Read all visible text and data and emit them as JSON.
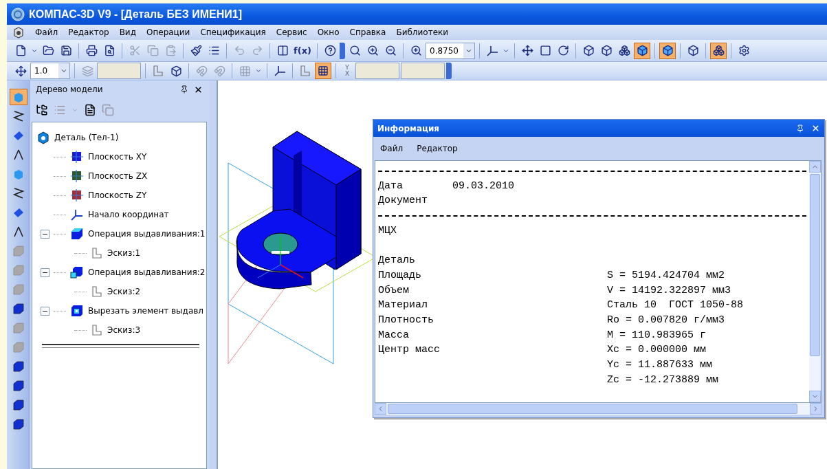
{
  "window": {
    "title": "КОМПАС-3D V9 - [Деталь БЕЗ ИМЕНИ1]"
  },
  "menu": [
    "Файл",
    "Редактор",
    "Вид",
    "Операции",
    "Спецификация",
    "Сервис",
    "Окно",
    "Справка",
    "Библиотеки"
  ],
  "toolbar": [
    {
      "kind": "new"
    },
    {
      "kind": "caret"
    },
    {
      "kind": "open"
    },
    {
      "kind": "save"
    },
    {
      "kind": "separator"
    },
    {
      "kind": "print"
    },
    {
      "kind": "preview"
    },
    {
      "kind": "separator"
    },
    {
      "kind": "cut",
      "disabled": true
    },
    {
      "kind": "copy",
      "disabled": true
    },
    {
      "kind": "paste",
      "disabled": true
    },
    {
      "kind": "separator"
    },
    {
      "kind": "brush"
    },
    {
      "kind": "list"
    },
    {
      "kind": "separator"
    },
    {
      "kind": "undo",
      "disabled": true
    },
    {
      "kind": "redo",
      "disabled": true
    },
    {
      "kind": "separator"
    },
    {
      "kind": "manager"
    },
    {
      "kind": "text",
      "label": "f(x)"
    },
    {
      "kind": "separator"
    },
    {
      "kind": "help"
    },
    {
      "kind": "grip"
    },
    {
      "kind": "search"
    },
    {
      "kind": "zoom-in"
    },
    {
      "kind": "zoom-out"
    },
    {
      "kind": "separator"
    },
    {
      "kind": "zoom-scale"
    },
    {
      "kind": "field",
      "value": "0.8750"
    },
    {
      "kind": "separator"
    },
    {
      "kind": "axes"
    },
    {
      "kind": "caret"
    },
    {
      "kind": "separator"
    },
    {
      "kind": "move"
    },
    {
      "kind": "frame"
    },
    {
      "kind": "rotate"
    },
    {
      "kind": "separator"
    },
    {
      "kind": "wire",
      "selected": false
    },
    {
      "kind": "hidden",
      "selected": false
    },
    {
      "kind": "thin",
      "selected": false
    },
    {
      "kind": "shaded",
      "selected": true
    },
    {
      "kind": "separator"
    },
    {
      "kind": "shaded-edges",
      "selected": true
    },
    {
      "kind": "separator"
    },
    {
      "kind": "perspective",
      "selected": false
    },
    {
      "kind": "separator"
    },
    {
      "kind": "section",
      "selected": true
    },
    {
      "kind": "separator"
    },
    {
      "kind": "gears"
    }
  ],
  "toolbar2": [
    {
      "kind": "dimension"
    },
    {
      "kind": "field",
      "value": "1.0"
    },
    {
      "kind": "separator"
    },
    {
      "kind": "layers",
      "disabled": true
    },
    {
      "kind": "empty-field"
    },
    {
      "kind": "separator"
    },
    {
      "kind": "sketch"
    },
    {
      "kind": "cube-edit"
    },
    {
      "kind": "separator"
    },
    {
      "kind": "magnet",
      "disabled": true
    },
    {
      "kind": "magnet",
      "disabled": true
    },
    {
      "kind": "separator"
    },
    {
      "kind": "grid",
      "disabled": true
    },
    {
      "kind": "caret"
    },
    {
      "kind": "separator"
    },
    {
      "kind": "local-axes"
    },
    {
      "kind": "separator"
    },
    {
      "kind": "ortho"
    },
    {
      "kind": "snap",
      "selected": true
    },
    {
      "kind": "separator"
    },
    {
      "kind": "coords",
      "top": "Y",
      "bottom": "X"
    },
    {
      "kind": "empty-field"
    },
    {
      "kind": "empty-field"
    },
    {
      "kind": "grip"
    }
  ],
  "left_tools": [
    {
      "selected": true,
      "disabled": false
    },
    {
      "selected": false,
      "disabled": false
    },
    {
      "selected": false,
      "disabled": false
    },
    {
      "selected": false,
      "disabled": false
    },
    {
      "selected": false,
      "disabled": false
    },
    {
      "selected": false,
      "disabled": false
    },
    {
      "selected": false,
      "disabled": false
    },
    {
      "selected": false,
      "disabled": false
    },
    {
      "selected": false,
      "disabled": true
    },
    {
      "selected": false,
      "disabled": true
    },
    {
      "selected": false,
      "disabled": true
    },
    {
      "selected": false,
      "disabled": false
    },
    {
      "selected": false,
      "disabled": true
    },
    {
      "selected": false,
      "disabled": true
    },
    {
      "selected": false,
      "disabled": false
    },
    {
      "selected": false,
      "disabled": false
    },
    {
      "selected": false,
      "disabled": false
    },
    {
      "selected": false,
      "disabled": false
    }
  ],
  "tree_panel": {
    "title": "Дерево модели",
    "root": {
      "label": "Деталь (Тел-1)",
      "kind": "part",
      "children": [
        {
          "label": "Плоскость XY",
          "kind": "plane",
          "color": "#1a1ad8"
        },
        {
          "label": "Плоскость ZX",
          "kind": "plane",
          "color": "#2e5a2e"
        },
        {
          "label": "Плоскость ZY",
          "kind": "plane",
          "color": "#a0303a"
        },
        {
          "label": "Начало координат",
          "kind": "origin"
        },
        {
          "label": "Операция выдавливания:1",
          "kind": "extrude",
          "expanded": true,
          "children": [
            {
              "label": "Эскиз:1",
              "kind": "sketch"
            }
          ]
        },
        {
          "label": "Операция выдавливания:2",
          "kind": "extrude2",
          "expanded": true,
          "children": [
            {
              "label": "Эскиз:2",
              "kind": "sketch"
            }
          ]
        },
        {
          "label": "Вырезать элемент выдавл",
          "kind": "cut",
          "expanded": true,
          "children": [
            {
              "label": "Эскиз:3",
              "kind": "sketch"
            }
          ]
        }
      ]
    }
  },
  "info_window": {
    "title": "Информация",
    "menu": [
      "Файл",
      "Редактор"
    ],
    "lines": [
      {
        "kind": "rule"
      },
      {
        "kind": "field",
        "label": "Дата",
        "value": "09.03.2010"
      },
      {
        "kind": "field",
        "label": "Документ"
      },
      {
        "kind": "rule"
      },
      {
        "kind": "field",
        "label": "МЦХ"
      },
      {
        "kind": "blank"
      },
      {
        "kind": "field",
        "label": "Деталь"
      },
      {
        "kind": "property",
        "label": "Площадь",
        "value": "S = 5194.424704 мм2"
      },
      {
        "kind": "property",
        "label": "Объем",
        "value": "V = 14192.322897 мм3"
      },
      {
        "kind": "property",
        "label": "Материал",
        "value": "Сталь 10  ГОСТ 1050-88"
      },
      {
        "kind": "property",
        "label": "Плотность",
        "value": "Ro = 0.007820 г/мм3"
      },
      {
        "kind": "property",
        "label": "Масса",
        "value": "M = 110.983965 г"
      },
      {
        "kind": "property",
        "label": "Центр масс",
        "value": "Xc = 0.000000 мм"
      },
      {
        "kind": "property",
        "value": "Yc = 11.887633 мм"
      },
      {
        "kind": "property",
        "value": "Zc = -12.273889 мм"
      }
    ]
  }
}
